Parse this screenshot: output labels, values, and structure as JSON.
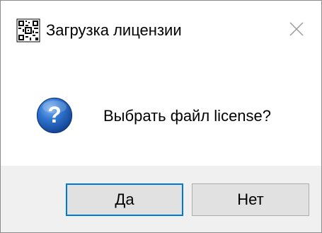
{
  "window": {
    "title": "Загрузка лицензии",
    "app_icon": "qr-code-icon",
    "close_icon": "close-icon"
  },
  "message": {
    "icon": "question-icon",
    "text": "Выбрать файл license?"
  },
  "buttons": {
    "yes_label": "Да",
    "no_label": "Нет"
  },
  "colors": {
    "footer_bg": "#f0f0f0",
    "button_bg": "#e1e1e1",
    "default_button_border": "#0078d7",
    "question_icon_blue": "#1f5fbf"
  }
}
